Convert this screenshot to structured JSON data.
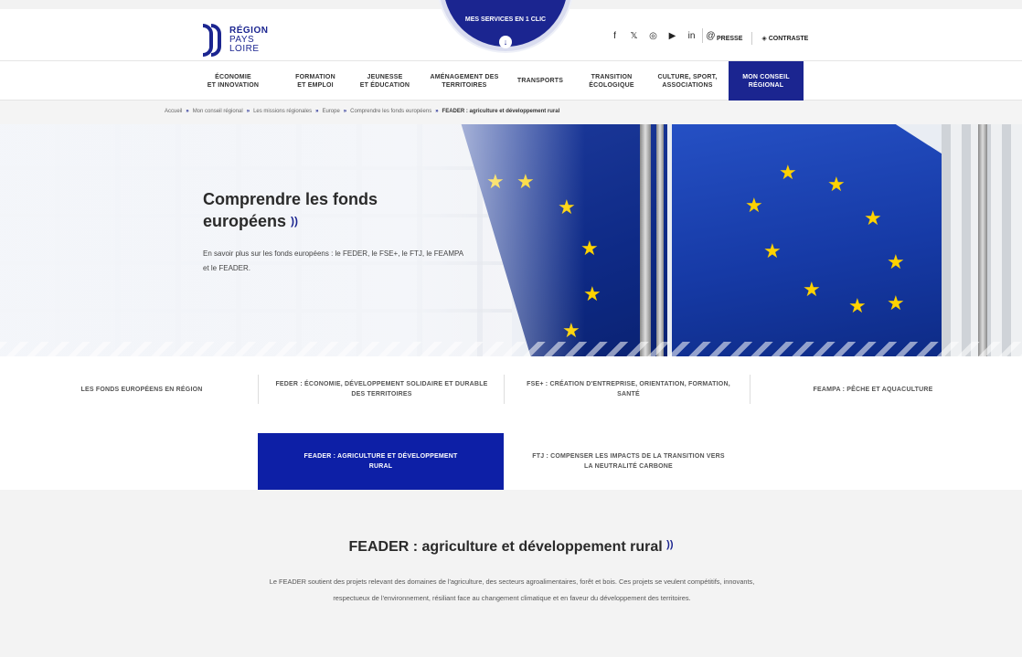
{
  "header": {
    "logo": {
      "line1": "RÉGION",
      "line2": "PAYS",
      "line3": "LOIRE"
    },
    "services": {
      "label": "MES SERVICES EN 1 CLIC"
    },
    "social": [
      "f",
      "𝕏",
      "◎",
      "▶",
      "in",
      "@"
    ],
    "links": {
      "presse": "PRESSE",
      "contraste": "◈ CONTRASTE"
    }
  },
  "nav": {
    "items": [
      {
        "label": "ÉCONOMIE\nET INNOVATION"
      },
      {
        "label": "FORMATION\nET EMPLOI"
      },
      {
        "label": "JEUNESSE\nET ÉDUCATION"
      },
      {
        "label": "AMÉNAGEMENT DES\nTERRITOIRES"
      },
      {
        "label": "TRANSPORTS"
      },
      {
        "label": "TRANSITION\nÉCOLOGIQUE"
      },
      {
        "label": "CULTURE, SPORT,\nASSOCIATIONS"
      },
      {
        "label": "MON CONSEIL\nRÉGIONAL"
      }
    ]
  },
  "breadcrumb": {
    "items": [
      "Accueil",
      "Mon conseil régional",
      "Les missions régionales",
      "Europe",
      "Comprendre les fonds européens"
    ],
    "current": "FEADER : agriculture et développement rural",
    "separator": "»"
  },
  "hero": {
    "title": "Comprendre les fonds européens",
    "subtitle": "En savoir plus sur les fonds européens : le FEDER, le FSE+, le FTJ, le FEAMPA et le FEADER."
  },
  "tabs": [
    {
      "label": "LES FONDS EUROPÉENS EN RÉGION"
    },
    {
      "label": "FEDER : ÉCONOMIE, DÉVELOPPEMENT SOLIDAIRE ET DURABLE DES TERRITOIRES"
    },
    {
      "label": "FSE+ : CRÉATION D'ENTREPRISE, ORIENTATION, FORMATION, SANTÉ"
    },
    {
      "label": "FEAMPA : PÊCHE ET AQUACULTURE"
    },
    {
      "label": "FEADER : AGRICULTURE ET DÉVELOPPEMENT RURAL"
    },
    {
      "label": "FTJ : COMPENSER LES IMPACTS DE LA TRANSITION VERS LA NEUTRALITÉ CARBONE"
    }
  ],
  "content": {
    "title": "FEADER : agriculture et développement rural",
    "text": "Le FEADER soutient des projets relevant des domaines de l'agriculture, des secteurs agroalimentaires, forêt et bois. Ces projets se veulent compétitifs, innovants, respectueux de l'environnement, résiliant face au changement climatique et en faveur du développement des territoires."
  },
  "colors": {
    "brand": "#1b2590",
    "active_tab": "#0d1fa6",
    "star": "#ffd200"
  }
}
